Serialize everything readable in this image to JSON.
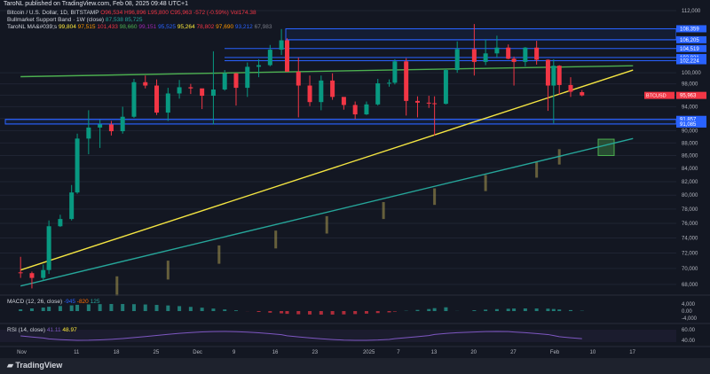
{
  "header": {
    "publish_line": "TaroNL published on TradingView.com, Feb 08, 2025 09:48 UTC+1"
  },
  "legend": {
    "symbol_line": {
      "name": "Bitcoin / U.S. Dollar, 1D, BITSTAMP",
      "o": "O96,534",
      "h": "H96,896",
      "l": "L95,800",
      "c": "C95,963",
      "chg": "-572 (-0.59%)",
      "vol": "Vol174.38"
    },
    "bmsb_line": {
      "name": "Bullmarket Support Band · 1W (close)",
      "v1": "87,538",
      "v2": "85,725"
    },
    "ma_line": {
      "name": "TaroNL MA&#039;s",
      "values": [
        "99,804",
        "97,515",
        "101,433",
        "98,660",
        "99,151",
        "95,525",
        "95,264",
        "78,802",
        "97,690",
        "93,212",
        "67,983"
      ]
    }
  },
  "colors": {
    "background": "#131722",
    "up": "#089981",
    "down": "#f23645",
    "yellow": "#f4e542",
    "teal": "#26a69a",
    "blue_box": "#2962ff",
    "price_tag": "#f23645"
  },
  "price_axis": {
    "ticks": [
      "112,000",
      "100,000",
      "98,000",
      "96,000",
      "94,000",
      "92,000",
      "90,000",
      "88,000",
      "86,000",
      "84,000",
      "82,000",
      "80,000",
      "78,000",
      "76,000",
      "74,000",
      "72,000",
      "70,000",
      "68,000"
    ],
    "level_tags": [
      "108,359",
      "106,205",
      "104,519",
      "102,821",
      "102,224",
      "91,857",
      "91,085"
    ],
    "current_symbol": "BTCUSD",
    "current_price": "95,963"
  },
  "time_axis": {
    "labels": [
      "Nov",
      "11",
      "18",
      "25",
      "Dec",
      "9",
      "16",
      "23",
      "2025",
      "7",
      "13",
      "20",
      "27",
      "Feb",
      "10",
      "17"
    ]
  },
  "macd": {
    "label": "MACD (12, 26, close)",
    "v1": "-945",
    "v2": "-820",
    "v3": "125",
    "ticks": [
      "4,000",
      "0.00",
      "-4,000"
    ]
  },
  "rsi": {
    "label": "RSI (14, close)",
    "v1": "41.11",
    "v2": "48.97",
    "ticks": [
      "60.00",
      "40.00"
    ]
  },
  "footer": {
    "brand": "TradingView"
  },
  "chart_data": {
    "type": "candlestick",
    "symbol": "BTCUSD",
    "interval": "1D",
    "candles": [
      {
        "d": "2024-11-01",
        "o": 69500,
        "h": 71500,
        "l": 68800,
        "c": 69400
      },
      {
        "d": "2024-11-03",
        "o": 69400,
        "h": 69600,
        "l": 67500,
        "c": 68800
      },
      {
        "d": "2024-11-05",
        "o": 68800,
        "h": 70500,
        "l": 68500,
        "c": 69800
      },
      {
        "d": "2024-11-06",
        "o": 69800,
        "h": 76400,
        "l": 69300,
        "c": 75600
      },
      {
        "d": "2024-11-08",
        "o": 75600,
        "h": 77200,
        "l": 75500,
        "c": 76600
      },
      {
        "d": "2024-11-10",
        "o": 76600,
        "h": 81500,
        "l": 76400,
        "c": 80400
      },
      {
        "d": "2024-11-11",
        "o": 80400,
        "h": 89500,
        "l": 80200,
        "c": 88700
      },
      {
        "d": "2024-11-13",
        "o": 88700,
        "h": 93400,
        "l": 86200,
        "c": 90500
      },
      {
        "d": "2024-11-15",
        "o": 90500,
        "h": 91800,
        "l": 87200,
        "c": 91000
      },
      {
        "d": "2024-11-17",
        "o": 91000,
        "h": 91600,
        "l": 89200,
        "c": 89900
      },
      {
        "d": "2024-11-19",
        "o": 89900,
        "h": 94000,
        "l": 89500,
        "c": 92300
      },
      {
        "d": "2024-11-21",
        "o": 92300,
        "h": 98900,
        "l": 92100,
        "c": 98300
      },
      {
        "d": "2024-11-23",
        "o": 98300,
        "h": 99500,
        "l": 97200,
        "c": 97700
      },
      {
        "d": "2024-11-25",
        "o": 97700,
        "h": 98800,
        "l": 92600,
        "c": 93000
      },
      {
        "d": "2024-11-27",
        "o": 93000,
        "h": 97300,
        "l": 91600,
        "c": 96300
      },
      {
        "d": "2024-11-29",
        "o": 96300,
        "h": 98700,
        "l": 95400,
        "c": 97400
      },
      {
        "d": "2024-12-01",
        "o": 97400,
        "h": 98000,
        "l": 96200,
        "c": 97200
      },
      {
        "d": "2024-12-03",
        "o": 97200,
        "h": 96500,
        "l": 93600,
        "c": 95900
      },
      {
        "d": "2024-12-05",
        "o": 95900,
        "h": 104000,
        "l": 91000,
        "c": 97000
      },
      {
        "d": "2024-12-07",
        "o": 97000,
        "h": 100500,
        "l": 96800,
        "c": 99900
      },
      {
        "d": "2024-12-09",
        "o": 99900,
        "h": 100000,
        "l": 94200,
        "c": 97300
      },
      {
        "d": "2024-12-11",
        "o": 97300,
        "h": 101900,
        "l": 95700,
        "c": 101100
      },
      {
        "d": "2024-12-13",
        "o": 101100,
        "h": 102500,
        "l": 99200,
        "c": 101400
      },
      {
        "d": "2024-12-15",
        "o": 101400,
        "h": 105200,
        "l": 101200,
        "c": 104300
      },
      {
        "d": "2024-12-17",
        "o": 104300,
        "h": 108300,
        "l": 103300,
        "c": 106100
      },
      {
        "d": "2024-12-18",
        "o": 106100,
        "h": 106500,
        "l": 100300,
        "c": 100200
      },
      {
        "d": "2024-12-20",
        "o": 100200,
        "h": 102800,
        "l": 92200,
        "c": 97700
      },
      {
        "d": "2024-12-22",
        "o": 97700,
        "h": 99500,
        "l": 94100,
        "c": 94800
      },
      {
        "d": "2024-12-24",
        "o": 94800,
        "h": 99500,
        "l": 93400,
        "c": 98600
      },
      {
        "d": "2024-12-26",
        "o": 98600,
        "h": 99900,
        "l": 95200,
        "c": 95700
      },
      {
        "d": "2024-12-28",
        "o": 95700,
        "h": 95500,
        "l": 93500,
        "c": 94300
      },
      {
        "d": "2024-12-30",
        "o": 94300,
        "h": 94900,
        "l": 91900,
        "c": 92700
      },
      {
        "d": "2025-01-01",
        "o": 92700,
        "h": 94900,
        "l": 92600,
        "c": 94400
      },
      {
        "d": "2025-01-03",
        "o": 94400,
        "h": 98900,
        "l": 94200,
        "c": 98100
      },
      {
        "d": "2025-01-05",
        "o": 98100,
        "h": 98800,
        "l": 97500,
        "c": 98200
      },
      {
        "d": "2025-01-06",
        "o": 98200,
        "h": 102500,
        "l": 97900,
        "c": 102100
      },
      {
        "d": "2025-01-08",
        "o": 102100,
        "h": 102700,
        "l": 92500,
        "c": 95000
      },
      {
        "d": "2025-01-10",
        "o": 95000,
        "h": 95800,
        "l": 92200,
        "c": 94700
      },
      {
        "d": "2025-01-12",
        "o": 94700,
        "h": 95900,
        "l": 93800,
        "c": 94600
      },
      {
        "d": "2025-01-13",
        "o": 94600,
        "h": 95800,
        "l": 89200,
        "c": 94500
      },
      {
        "d": "2025-01-15",
        "o": 94500,
        "h": 100700,
        "l": 94400,
        "c": 100500
      },
      {
        "d": "2025-01-17",
        "o": 100500,
        "h": 105900,
        "l": 100000,
        "c": 104400
      },
      {
        "d": "2025-01-20",
        "o": 104400,
        "h": 109300,
        "l": 99500,
        "c": 102000
      },
      {
        "d": "2025-01-22",
        "o": 102000,
        "h": 106300,
        "l": 101400,
        "c": 103600
      },
      {
        "d": "2025-01-24",
        "o": 103600,
        "h": 107000,
        "l": 102800,
        "c": 104700
      },
      {
        "d": "2025-01-26",
        "o": 104700,
        "h": 105300,
        "l": 102500,
        "c": 102600
      },
      {
        "d": "2025-01-27",
        "o": 102600,
        "h": 103000,
        "l": 97700,
        "c": 102000
      },
      {
        "d": "2025-01-29",
        "o": 102000,
        "h": 104800,
        "l": 101200,
        "c": 104700
      },
      {
        "d": "2025-01-31",
        "o": 104700,
        "h": 106000,
        "l": 101500,
        "c": 102400
      },
      {
        "d": "2025-02-02",
        "o": 102400,
        "h": 102500,
        "l": 93300,
        "c": 97700
      },
      {
        "d": "2025-02-03",
        "o": 97700,
        "h": 102500,
        "l": 91200,
        "c": 101300
      },
      {
        "d": "2025-02-04",
        "o": 101300,
        "h": 101400,
        "l": 96100,
        "c": 97800
      },
      {
        "d": "2025-02-06",
        "o": 97800,
        "h": 99200,
        "l": 95700,
        "c": 96600
      },
      {
        "d": "2025-02-08",
        "o": 96534,
        "h": 96896,
        "l": 95800,
        "c": 95963
      }
    ],
    "horizontal_levels": [
      108359,
      106205,
      104519,
      102821,
      102224,
      91857,
      91085
    ],
    "trendlines": [
      {
        "name": "yellow",
        "from": {
          "d": "2024-11-01",
          "p": 69800
        },
        "to": {
          "d": "2025-02-17",
          "p": 100500
        }
      },
      {
        "name": "teal",
        "from": {
          "d": "2024-11-01",
          "p": 67800
        },
        "to": {
          "d": "2025-02-17",
          "p": 88700
        }
      },
      {
        "name": "green-upper",
        "from": {
          "d": "2024-11-01",
          "p": 99300
        },
        "to": {
          "d": "2025-02-17",
          "p": 101300
        }
      }
    ],
    "bmsb": {
      "v1": 87538,
      "v2": 85725
    },
    "current_price": 95963,
    "ylim": [
      67000,
      112000
    ],
    "y_scale": "log"
  }
}
